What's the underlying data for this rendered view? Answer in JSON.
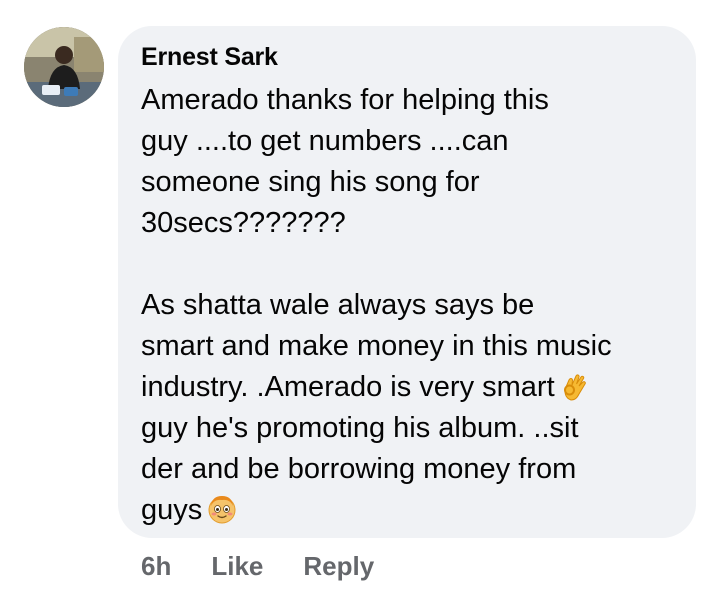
{
  "comment": {
    "author": "Ernest Sark",
    "paragraph_1": "Amerado thanks for helping this\nguy ....to get numbers ....can\nsomeone sing his song for\n30secs???????",
    "paragraph_2a": "As shatta wale  always  says be\nsmart and make money in this music\nindustry. .Amerado is very smart",
    "paragraph_2b": "guy he's promoting his album. ..sit\nder and be borrowing money from\nguys",
    "emoji_1": "ok-hand-emoji",
    "emoji_2": "blushing-face-emoji",
    "bubble_color": "#f0f2f5"
  },
  "actions": {
    "time": "6h",
    "like_label": "Like",
    "reply_label": "Reply",
    "text_color": "#65676b"
  }
}
